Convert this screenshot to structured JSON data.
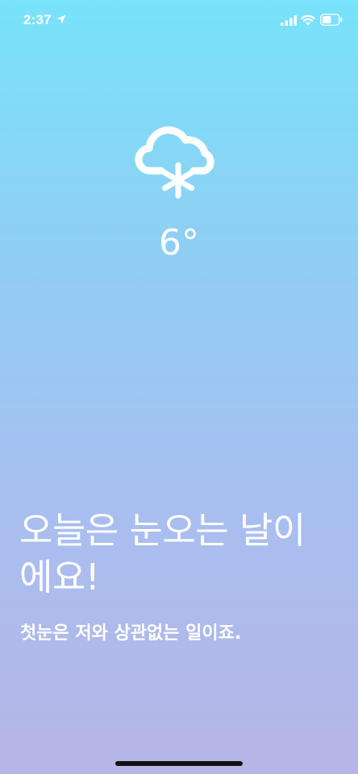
{
  "status_bar": {
    "time": "2:37"
  },
  "weather": {
    "icon": "cloud-snow-icon",
    "temperature": "6°"
  },
  "message": {
    "headline_line1": "오늘은 눈오는 날이",
    "headline_line2": "에요!",
    "subtitle": "첫눈은 저와 상관없는 일이죠."
  },
  "colors": {
    "gradient_top": "#78e3fb",
    "gradient_bottom": "#b6b5e6",
    "text": "#ffffff"
  }
}
